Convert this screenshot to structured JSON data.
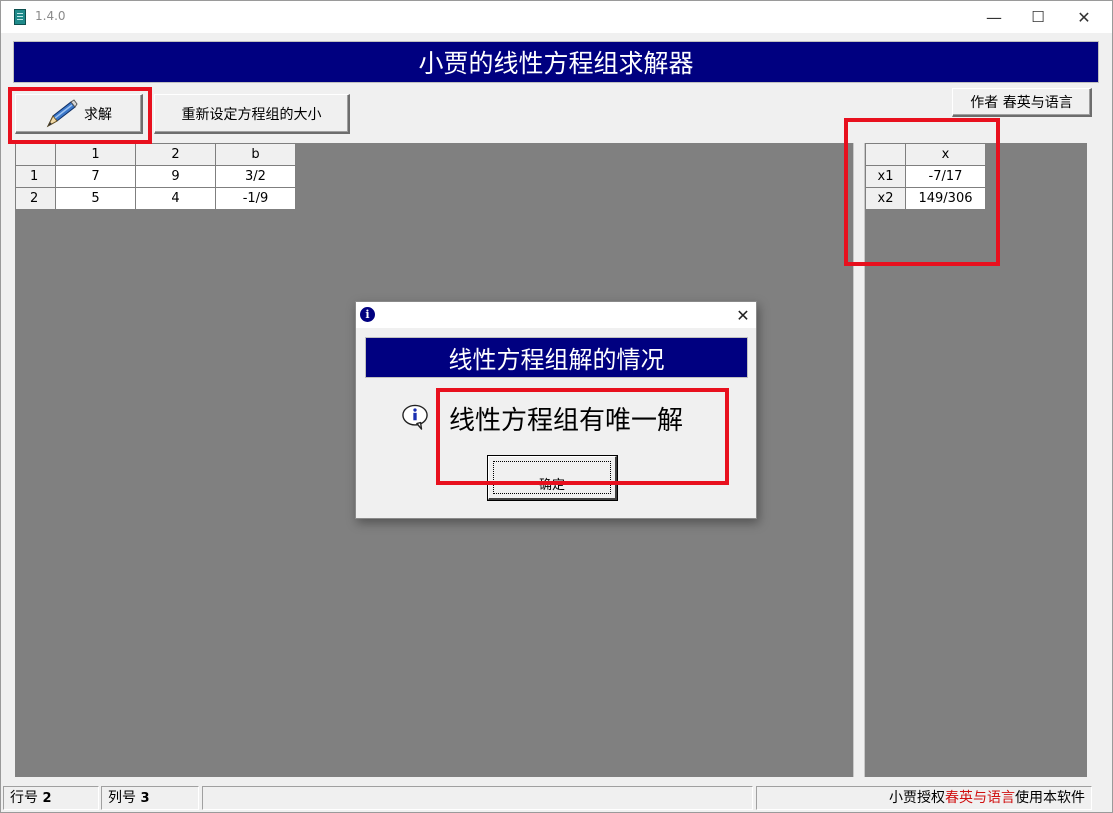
{
  "window": {
    "title": "1.4.0",
    "controls": {
      "minimize": "—",
      "maximize": "☐",
      "close": "✕"
    }
  },
  "banner": {
    "title": "小贾的线性方程组求解器"
  },
  "toolbar": {
    "solve_label": "求解",
    "resize_label": "重新设定方程组的大小",
    "author_label": "作者 春英与语言"
  },
  "coefficient_grid": {
    "headers": [
      "",
      "1",
      "2",
      "b"
    ],
    "rows": [
      [
        "1",
        "7",
        "9",
        "3/2"
      ],
      [
        "2",
        "5",
        "4",
        "-1/9"
      ]
    ]
  },
  "solution_grid": {
    "headers": [
      "",
      "x"
    ],
    "rows": [
      [
        "x1",
        "-7/17"
      ],
      [
        "x2",
        "149/306"
      ]
    ]
  },
  "statusbar": {
    "row_label": "行号",
    "row_value": "2",
    "col_label": "列号",
    "col_value": "3",
    "license_prefix": "小贾授权",
    "license_highlight": "春英与语言",
    "license_suffix": "使用本软件"
  },
  "dialog": {
    "close": "✕",
    "info_glyph": "i",
    "banner": "线性方程组解的情况",
    "message": "线性方程组有唯一解",
    "ok_label": "确定"
  },
  "colors": {
    "banner_bg": "#000080",
    "highlight": "#e8101e",
    "grid_bg": "#808080",
    "license_highlight": "#d01010"
  }
}
